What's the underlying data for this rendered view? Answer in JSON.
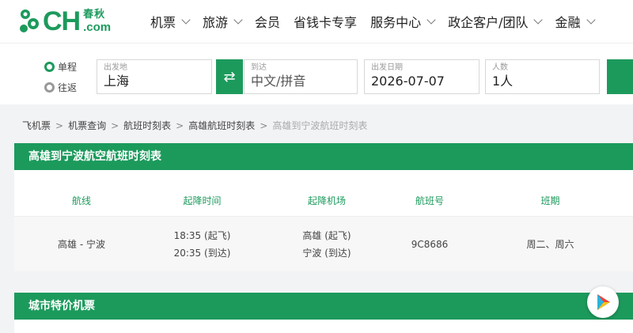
{
  "logo": {
    "mark": "CH",
    "cn": "春秋",
    "com": ".com",
    "brand_color": "#1c9a5c"
  },
  "nav": [
    {
      "label": "机票",
      "has_menu": true
    },
    {
      "label": "旅游",
      "has_menu": true
    },
    {
      "label": "会员",
      "has_menu": false
    },
    {
      "label": "省钱卡专享",
      "has_menu": false
    },
    {
      "label": "服务中心",
      "has_menu": true
    },
    {
      "label": "政企客户/团队",
      "has_menu": true
    },
    {
      "label": "金融",
      "has_menu": true
    }
  ],
  "search": {
    "trip_types": [
      {
        "label": "单程",
        "selected": true
      },
      {
        "label": "往返",
        "selected": false
      }
    ],
    "from": {
      "label": "出发地",
      "value": "上海"
    },
    "swap_icon": "⇄",
    "to": {
      "label": "到达",
      "placeholder": "中文/拼音"
    },
    "date": {
      "label": "出发日期",
      "value": "2026-07-07"
    },
    "passengers": {
      "label": "人数",
      "value": "1人"
    }
  },
  "breadcrumb": {
    "items": [
      "飞机票",
      "机票查询",
      "航班时刻表",
      "高雄航班时刻表"
    ],
    "current": "高雄到宁波航班时刻表",
    "separator": ">"
  },
  "schedule": {
    "title": "高雄到宁波航空航班时刻表",
    "columns": [
      "航线",
      "起降时间",
      "起降机场",
      "航班号",
      "班期"
    ],
    "rows": [
      {
        "route": "高雄 - 宁波",
        "depart_time": "18:35 (起飞)",
        "arrive_time": "20:35 (到达)",
        "depart_airport": "高雄 (起飞)",
        "arrive_airport": "宁波 (到达)",
        "flight_no": "9C8686",
        "days": "周二、周六"
      }
    ]
  },
  "deals": {
    "title": "城市特价机票"
  }
}
